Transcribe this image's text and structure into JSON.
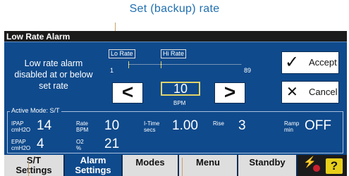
{
  "callouts": {
    "top": "Set (backup) rate"
  },
  "window": {
    "title": "Low Rate Alarm"
  },
  "message": "Low rate alarm disabled at or below set rate",
  "slider": {
    "lo_label": "Lo Rate",
    "hi_label": "Hi Rate",
    "min": "1",
    "max": "89"
  },
  "setting": {
    "value": "10",
    "unit": "BPM",
    "decrease_glyph": "<",
    "increase_glyph": ">"
  },
  "buttons": {
    "accept": "Accept",
    "cancel": "Cancel"
  },
  "active_mode": {
    "title": "Active Mode: S/T",
    "ipap_label": "IPAP",
    "ipap_unit": "cmH2O",
    "ipap_value": "14",
    "rate_label": "Rate",
    "rate_unit": "BPM",
    "rate_value": "10",
    "itime_label": "I-Time",
    "itime_unit": "secs",
    "itime_value": "1.00",
    "rise_label": "Rise",
    "rise_value": "3",
    "ramp_label": "Ramp",
    "ramp_unit": "min",
    "ramp_value": "OFF",
    "epap_label": "EPAP",
    "epap_unit": "cmH2O",
    "epap_value": "4",
    "o2_label": "O2",
    "o2_unit": "%",
    "o2_value": "21"
  },
  "tabs": {
    "st_line1": "S/T",
    "st_line2": "Settings",
    "alarm_line1": "Alarm",
    "alarm_line2": "Settings",
    "modes": "Modes",
    "menu": "Menu",
    "standby": "Standby"
  },
  "help_glyph": "?",
  "colors": {
    "screen": "#0f4a8c",
    "accent": "#e0d46a",
    "callout": "#1f6fb0",
    "help": "#e8cf1a"
  }
}
